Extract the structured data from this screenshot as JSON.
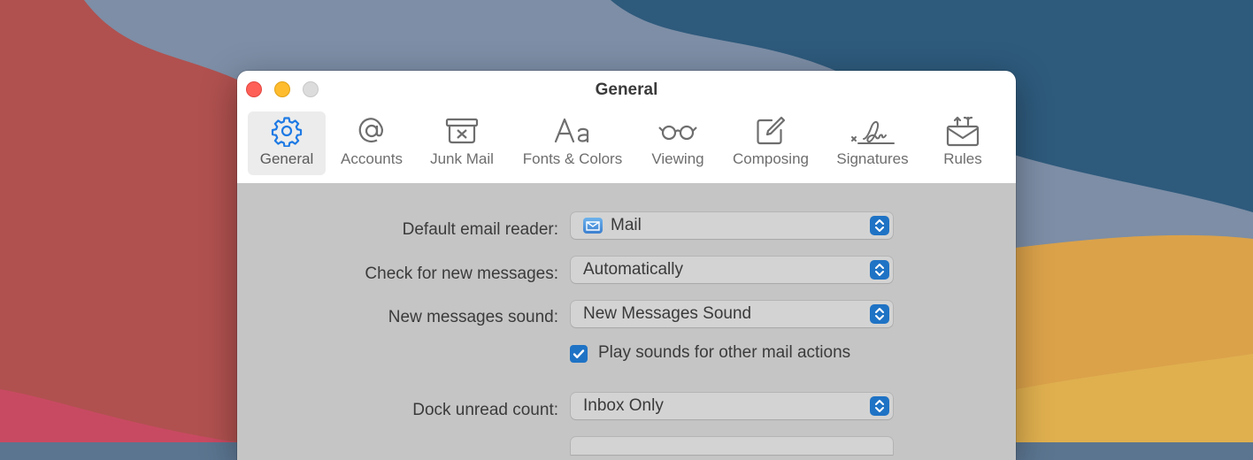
{
  "window": {
    "title": "General"
  },
  "toolbar": {
    "items": [
      {
        "label": "General",
        "icon": "gear-icon",
        "active": true
      },
      {
        "label": "Accounts",
        "icon": "at-sign-icon",
        "active": false
      },
      {
        "label": "Junk Mail",
        "icon": "junk-bin-icon",
        "active": false
      },
      {
        "label": "Fonts & Colors",
        "icon": "font-aa-icon",
        "active": false
      },
      {
        "label": "Viewing",
        "icon": "glasses-icon",
        "active": false
      },
      {
        "label": "Composing",
        "icon": "compose-icon",
        "active": false
      },
      {
        "label": "Signatures",
        "icon": "signature-icon",
        "active": false
      },
      {
        "label": "Rules",
        "icon": "envelope-rules-icon",
        "active": false
      }
    ]
  },
  "settings": {
    "default_reader": {
      "label": "Default email reader:",
      "value": "Mail",
      "icon": "mail-app-icon"
    },
    "check_messages": {
      "label": "Check for new messages:",
      "value": "Automatically"
    },
    "new_sound": {
      "label": "New messages sound:",
      "value": "New Messages Sound"
    },
    "play_sounds": {
      "label": "Play sounds for other mail actions",
      "checked": true
    },
    "dock_unread": {
      "label": "Dock unread count:",
      "value": "Inbox Only"
    }
  },
  "colors": {
    "accent": "#1f73c5",
    "toolbar_icon_active": "#1e7ae4",
    "close": "#fe5f57",
    "minimize": "#febc2e",
    "zoom": "#dcdcdc"
  }
}
